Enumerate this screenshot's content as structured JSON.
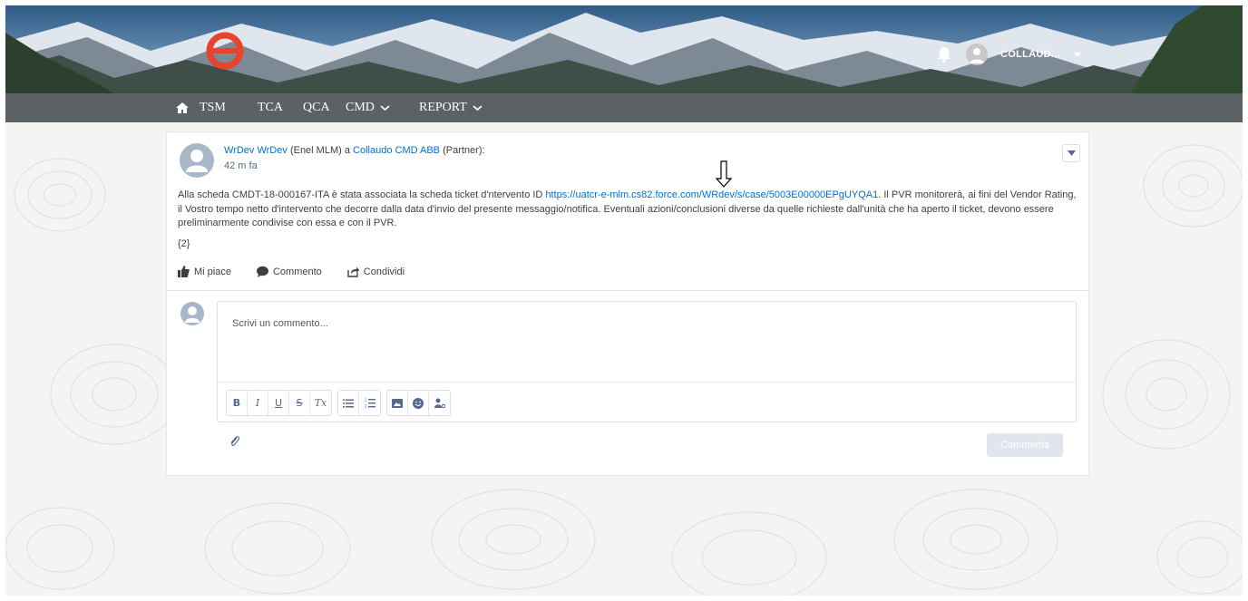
{
  "header": {
    "username": "COLLAUD...",
    "logo_icon": "enel-logo-icon",
    "bell_icon": "bell-icon",
    "avatar_icon": "user-avatar-icon"
  },
  "nav": {
    "items": [
      {
        "label": "TSM"
      },
      {
        "label": "TCA"
      },
      {
        "label": "QCA"
      },
      {
        "label": "CMD",
        "has_dropdown": true
      },
      {
        "label": "REPORT",
        "has_dropdown": true
      }
    ]
  },
  "post": {
    "author": "WrDev WrDev",
    "author_org": "(Enel MLM) a",
    "target": "Collaudo CMD ABB",
    "target_suffix": "(Partner):",
    "time": "42 m fa",
    "body_prefix": "Alla scheda CMDT-18-000167-ITA è stata associata la scheda ticket d'ntervento ID ",
    "body_link": "https://uatcr-e-mlm.cs82.force.com/WRdev/s/case/5003E00000EPgUYQA1",
    "body_suffix": ". Il PVR monitorerà, ai fini del Vendor Rating, il Vostro tempo netto d'intervento che decorre dalla data d'invio del presente messaggio/notifica. Eventuali azioni/conclusioni diverse da quelle richieste dall'unità che ha aperto il ticket, devono essere preliminarmente condivise con essa e con il PVR.",
    "count": "{2}",
    "actions": {
      "like": "Mi piace",
      "comment": "Commento",
      "share": "Condividi"
    }
  },
  "comment_box": {
    "placeholder": "Scrivi un commento...",
    "submit_label": "Commenta",
    "toolbar": [
      "B",
      "I",
      "U",
      "S",
      "Tx",
      "bullet-list",
      "numbered-list",
      "image",
      "emoji",
      "mention"
    ]
  },
  "colors": {
    "link": "#0070d2",
    "navbar": "#4e5458",
    "logo": "#e8432d"
  }
}
